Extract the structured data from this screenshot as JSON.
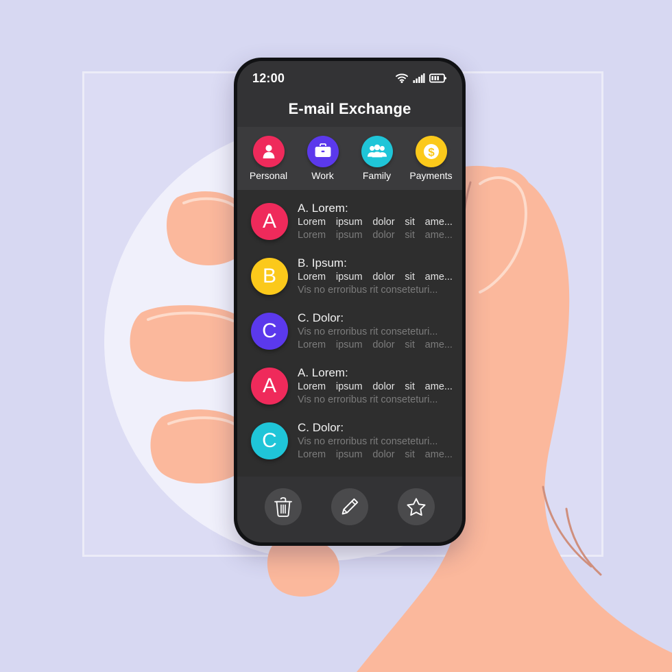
{
  "theme": {
    "page_background": "#d7d8f2",
    "frame_stroke": "#eceef9",
    "halo": "#f0f0fb",
    "skin": "#fbb89c",
    "skin_shadow": "#f2a98f",
    "phone_body": "#111214",
    "screen_background": "#2e2e2e",
    "bar_background": "#333335",
    "category_background": "#3b3b3d",
    "accent_pink": "#ef2a5b",
    "accent_yellow": "#fbc91b",
    "accent_purple": "#5b39ec",
    "accent_cyan": "#1fc5d8",
    "text_primary": "#f2f2f2",
    "text_muted": "#7c7c7c"
  },
  "status_bar": {
    "time": "12:00",
    "icons": [
      {
        "name": "wifi-icon",
        "label": "wifi"
      },
      {
        "name": "cellular-signal-icon",
        "label": "signal"
      },
      {
        "name": "battery-icon",
        "label": "battery"
      }
    ]
  },
  "header": {
    "title": "E-mail Exchange"
  },
  "categories": [
    {
      "label": "Personal",
      "icon": "person-icon",
      "color": "#ef2a5b"
    },
    {
      "label": "Work",
      "icon": "briefcase-icon",
      "color": "#5b39ec"
    },
    {
      "label": "Family",
      "icon": "group-icon",
      "color": "#1fc5d8"
    },
    {
      "label": "Payments",
      "icon": "dollar-icon",
      "color": "#fbc91b"
    }
  ],
  "mail_list": [
    {
      "avatar_letter": "A",
      "avatar_color": "#ef2a5b",
      "sender": "A. Lorem:",
      "preview_1": "Lorem ipsum dolor sit ame...",
      "preview_1_words": [
        "Lorem",
        "ipsum",
        "dolor",
        "sit",
        "ame..."
      ],
      "preview_1_state": "bright",
      "preview_2": "Lorem ipsum dolor sit ame...",
      "preview_2_words": [
        "Lorem",
        "ipsum",
        "dolor",
        "sit",
        "ame..."
      ],
      "preview_2_state": "dim"
    },
    {
      "avatar_letter": "B",
      "avatar_color": "#fbc91b",
      "sender": "B. Ipsum:",
      "preview_1": "Lorem ipsum dolor sit ame...",
      "preview_1_words": [
        "Lorem",
        "ipsum",
        "dolor",
        "sit",
        "ame..."
      ],
      "preview_1_state": "bright",
      "preview_2": "Vis no erroribus rit conseteturi...",
      "preview_2_words": null,
      "preview_2_state": "dim"
    },
    {
      "avatar_letter": "C",
      "avatar_color": "#5b39ec",
      "sender": "C. Dolor:",
      "preview_1": "Vis no erroribus rit conseteturi...",
      "preview_1_words": null,
      "preview_1_state": "dim",
      "preview_2": "Lorem ipsum dolor sit ame...",
      "preview_2_words": [
        "Lorem",
        "ipsum",
        "dolor",
        "sit",
        "ame..."
      ],
      "preview_2_state": "dim"
    },
    {
      "avatar_letter": "A",
      "avatar_color": "#ef2a5b",
      "sender": "A. Lorem:",
      "preview_1": "Lorem ipsum dolor sit ame...",
      "preview_1_words": [
        "Lorem",
        "ipsum",
        "dolor",
        "sit",
        "ame..."
      ],
      "preview_1_state": "bright",
      "preview_2": "Vis no erroribus rit conseteturi...",
      "preview_2_words": null,
      "preview_2_state": "dim"
    },
    {
      "avatar_letter": "C",
      "avatar_color": "#1fc5d8",
      "sender": "C. Dolor:",
      "preview_1": "Vis no erroribus rit conseteturi...",
      "preview_1_words": null,
      "preview_1_state": "dim",
      "preview_2": "Lorem ipsum dolor sit ame...",
      "preview_2_words": [
        "Lorem",
        "ipsum",
        "dolor",
        "sit",
        "ame..."
      ],
      "preview_2_state": "dim"
    }
  ],
  "actions": [
    {
      "name": "delete-button",
      "icon": "trash-icon",
      "label": "Delete"
    },
    {
      "name": "compose-button",
      "icon": "pencil-icon",
      "label": "Compose"
    },
    {
      "name": "favorite-button",
      "icon": "star-icon",
      "label": "Favorite"
    }
  ]
}
